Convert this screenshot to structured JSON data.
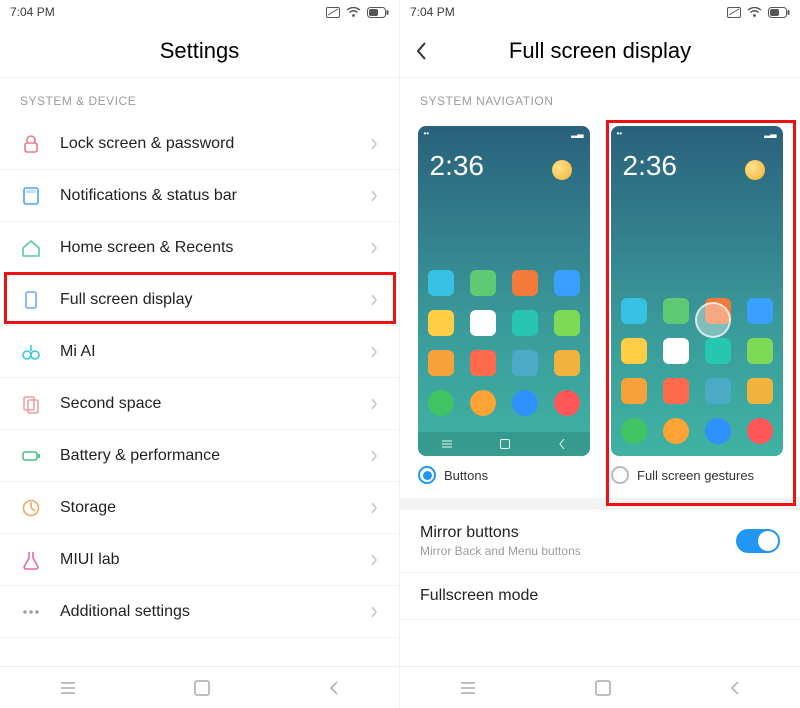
{
  "status": {
    "time": "7:04 PM"
  },
  "left": {
    "title": "Settings",
    "section": "SYSTEM & DEVICE",
    "items": [
      {
        "label": "Lock screen & password",
        "icon": "lock",
        "color": "#e97a8a"
      },
      {
        "label": "Notifications & status bar",
        "icon": "notif",
        "color": "#4aa3ff"
      },
      {
        "label": "Home screen & Recents",
        "icon": "home",
        "color": "#5fc99c"
      },
      {
        "label": "Full screen display",
        "icon": "screen",
        "color": "#6aa9ff"
      },
      {
        "label": "Mi AI",
        "icon": "miai",
        "color": "#36c7e0"
      },
      {
        "label": "Second space",
        "icon": "second",
        "color": "#e8a1a1"
      },
      {
        "label": "Battery & performance",
        "icon": "battery",
        "color": "#4dc486"
      },
      {
        "label": "Storage",
        "icon": "storage",
        "color": "#f2a766"
      },
      {
        "label": "MIUI lab",
        "icon": "lab",
        "color": "#e76aa8"
      },
      {
        "label": "Additional settings",
        "icon": "more",
        "color": "#9aa0a6"
      }
    ]
  },
  "right": {
    "title": "Full screen display",
    "section": "SYSTEM NAVIGATION",
    "phone_clock": "2:36",
    "options": {
      "buttons": "Buttons",
      "gestures": "Full screen gestures"
    },
    "selected": "buttons",
    "mirror": {
      "title": "Mirror buttons",
      "subtitle": "Mirror Back and Menu buttons",
      "on": true
    },
    "fullscreen_mode": "Fullscreen mode"
  }
}
